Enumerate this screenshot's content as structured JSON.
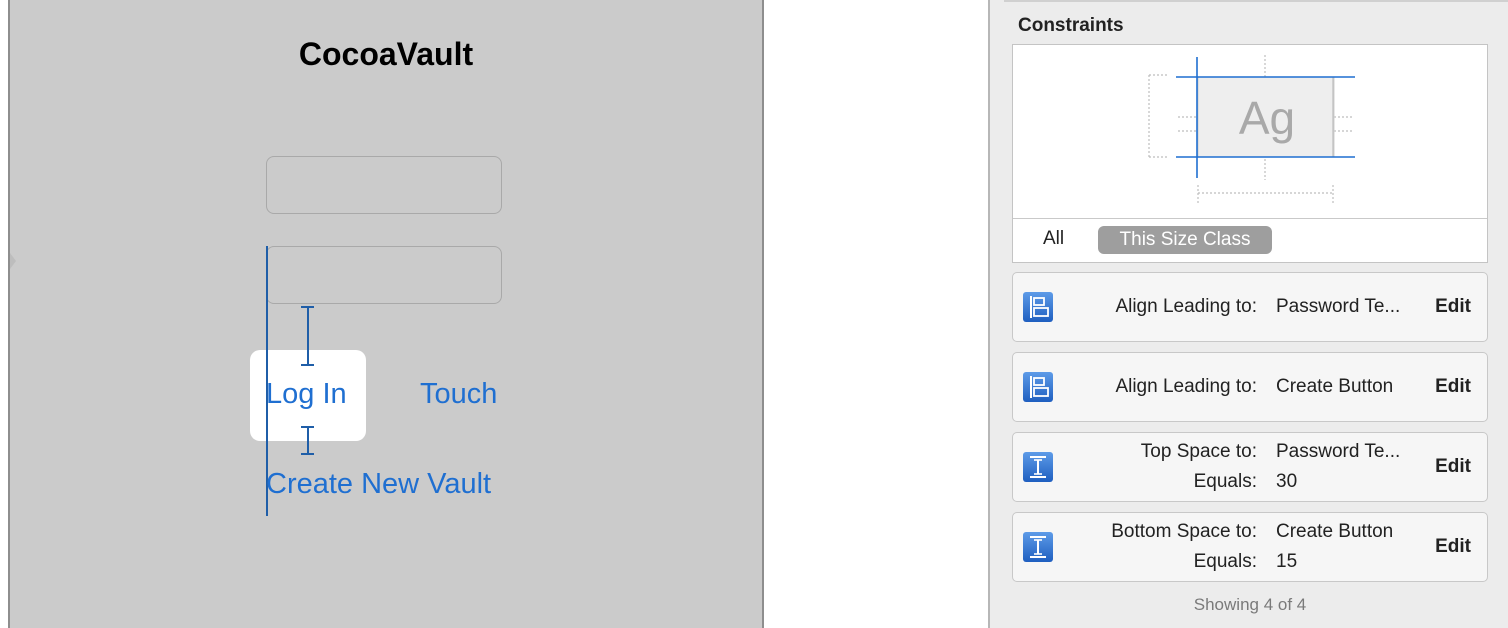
{
  "canvas": {
    "app_title": "CocoaVault",
    "buttons": {
      "login": "Log In",
      "touch": "Touch",
      "create": "Create New Vault"
    },
    "accent_color": "#1f6fd1"
  },
  "inspector": {
    "header": "Constraints",
    "preview": {
      "sample_text": "Ag",
      "tab_all": "All",
      "tab_size_class": "This Size Class"
    },
    "constraints": [
      {
        "icon": "align-leading-icon",
        "rows": [
          {
            "label": "Align Leading to:",
            "value": "Password Te..."
          }
        ],
        "action": "Edit"
      },
      {
        "icon": "align-leading-icon",
        "rows": [
          {
            "label": "Align Leading to:",
            "value": "Create Button"
          }
        ],
        "action": "Edit"
      },
      {
        "icon": "vertical-space-icon",
        "rows": [
          {
            "label": "Top Space to:",
            "value": "Password Te..."
          },
          {
            "label": "Equals:",
            "value": "30"
          }
        ],
        "action": "Edit"
      },
      {
        "icon": "vertical-space-icon",
        "rows": [
          {
            "label": "Bottom Space to:",
            "value": "Create Button"
          },
          {
            "label": "Equals:",
            "value": "15"
          }
        ],
        "action": "Edit"
      }
    ],
    "footer": "Showing 4 of 4"
  }
}
